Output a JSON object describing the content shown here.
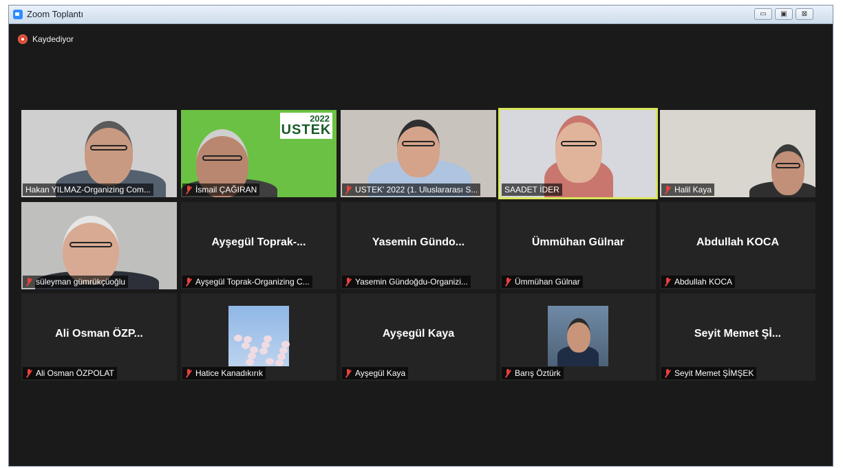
{
  "window": {
    "title": "Zoom Toplantı"
  },
  "window_controls": {
    "minimize": "▭",
    "maximize": "▣",
    "close": "⊠"
  },
  "recording": {
    "label": "Kaydediyor"
  },
  "participants": [
    {
      "name": "Hakan YILMAZ-Organizing Com...",
      "muted": false,
      "video": true,
      "bg": "#cfcfcf"
    },
    {
      "name": "İsmail ÇAĞIRAN",
      "muted": true,
      "video": true,
      "bg": "#6bc143",
      "logo_year": "2022",
      "logo_text": "USTEK"
    },
    {
      "name": "USTEK' 2022 (1. Uluslararası S...",
      "muted": true,
      "video": true,
      "bg": "#c9c3bd"
    },
    {
      "name": "SAADET İDER",
      "muted": false,
      "video": true,
      "bg": "#d6d8dd",
      "active": true
    },
    {
      "name": "Halil Kaya",
      "muted": true,
      "video": true,
      "bg": "#d9d6cf"
    },
    {
      "name": "süleyman gümrükçüoğlu",
      "muted": true,
      "video": true,
      "bg": "#bfc0bd"
    },
    {
      "name": "Ayşegül Toprak-Organizing C...",
      "display": "Ayşegül  Toprak-...",
      "muted": true,
      "video": false
    },
    {
      "name": "Yasemin Gündoğdu-Organizi...",
      "display": "Yasemin  Gündo...",
      "muted": true,
      "video": false
    },
    {
      "name": "Ümmühan Gülnar",
      "display": "Ümmühan Gülnar",
      "muted": true,
      "video": false
    },
    {
      "name": "Abdullah KOCA",
      "display": "Abdullah KOCA",
      "muted": true,
      "video": false
    },
    {
      "name": "Ali Osman ÖZPOLAT",
      "display": "Ali Osman ÖZP...",
      "muted": true,
      "video": false
    },
    {
      "name": "Hatice Kanadıkırık",
      "muted": true,
      "video": false,
      "avatar": "blossom"
    },
    {
      "name": "Ayşegül Kaya",
      "display": "Ayşegül Kaya",
      "muted": true,
      "video": false
    },
    {
      "name": "Barış Öztürk",
      "muted": true,
      "video": false,
      "avatar": "photo"
    },
    {
      "name": "Seyit Memet ŞİMŞEK",
      "display": "Seyit  Memet  Şİ...",
      "muted": true,
      "video": false
    }
  ],
  "colors": {
    "accent_active": "#d9e65a",
    "muted_red": "#e8423b",
    "record_red": "#e04a35"
  }
}
